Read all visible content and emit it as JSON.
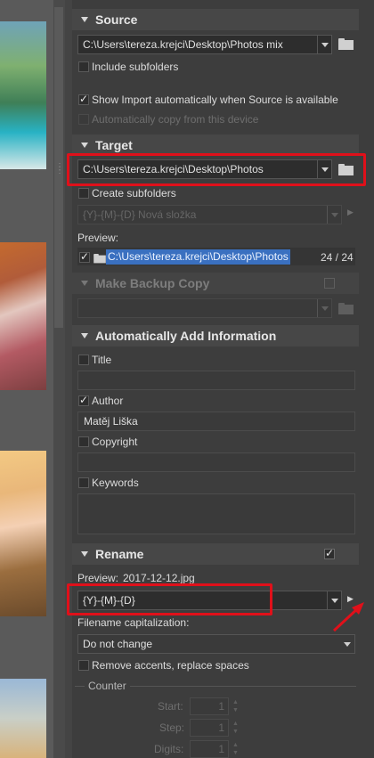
{
  "source": {
    "header": "Source",
    "path": "C:\\Users\\tereza.krejci\\Desktop\\Photos mix",
    "include_subfolders_label": "Include subfolders",
    "show_import_label": "Show Import automatically when Source is available",
    "auto_copy_label": "Automatically copy from this device"
  },
  "target": {
    "header": "Target",
    "path": "C:\\Users\\tereza.krejci\\Desktop\\Photos",
    "create_subfolders_label": "Create subfolders",
    "subfolder_pattern": "{Y}-{M}-{D} Nová složka",
    "preview_label": "Preview:",
    "preview_path": "C:\\Users\\tereza.krejci\\Desktop\\Photos",
    "preview_count": "24 / 24"
  },
  "backup": {
    "header": "Make Backup Copy"
  },
  "add_info": {
    "header": "Automatically Add Information",
    "title_label": "Title",
    "author_label": "Author",
    "author_value": "Matěj Liška",
    "copyright_label": "Copyright",
    "keywords_label": "Keywords"
  },
  "rename": {
    "header": "Rename",
    "preview_label": "Preview:",
    "preview_value": "2017-12-12.jpg",
    "pattern": "{Y}-{M}-{D}",
    "capitalization_label": "Filename capitalization:",
    "capitalization_value": "Do not change",
    "remove_accents_label": "Remove accents, replace spaces",
    "counter_label": "Counter",
    "start_label": "Start:",
    "start_value": "1",
    "step_label": "Step:",
    "step_value": "1",
    "digits_label": "Digits:",
    "digits_value": "1"
  },
  "colors": {
    "highlight": "#e0101a",
    "selection": "#3a70c0"
  }
}
